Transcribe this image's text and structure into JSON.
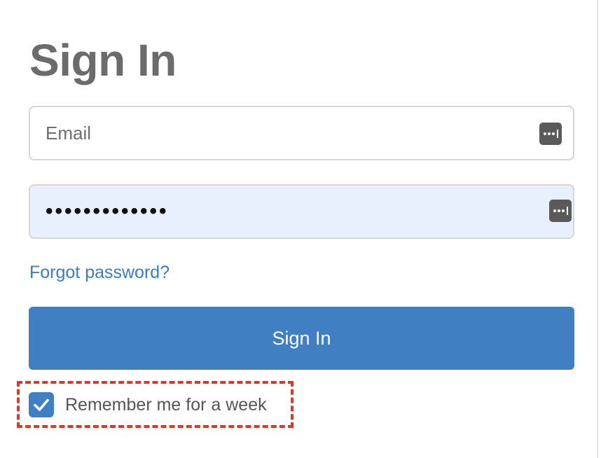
{
  "page": {
    "title": "Sign In"
  },
  "form": {
    "email": {
      "placeholder": "Email",
      "value": ""
    },
    "password": {
      "value": "•••••••••••••"
    },
    "password_manager_icon": "keychain-icon",
    "forgot_password_label": "Forgot password?",
    "submit_label": "Sign In",
    "remember_me": {
      "label": "Remember me for a week",
      "checked": true
    }
  },
  "colors": {
    "title": "#6b6b6b",
    "link": "#3a7dc2",
    "primary": "#3f7fc2",
    "autofill_background": "#e8effd",
    "highlight_border": "#d63a2c"
  }
}
